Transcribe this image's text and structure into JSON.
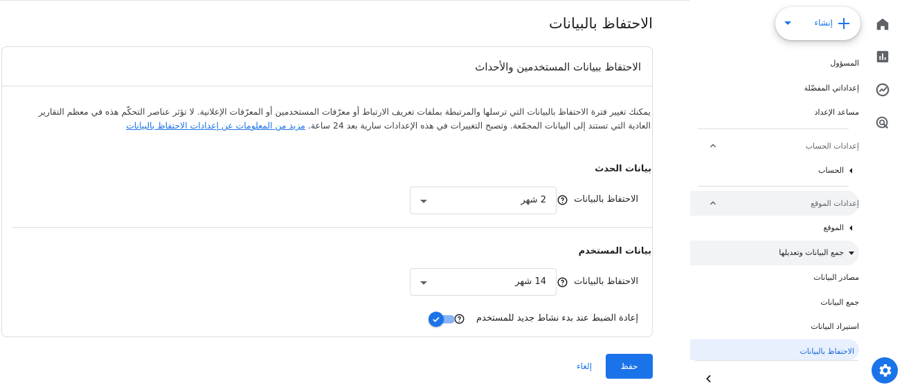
{
  "page": {
    "title": "الاحتفاظ بالبيانات"
  },
  "create_button": {
    "label": "إنشاء"
  },
  "nav": {
    "items_top": [
      "المسؤول",
      "إعداداتي المفضّلة",
      "مساعد الإعداد"
    ],
    "account_section": {
      "label": "إعدادات الحساب",
      "child": "الحساب"
    },
    "property_section": {
      "label": "إعدادات الموقع",
      "child": "الموقع"
    },
    "data_collection": {
      "label": "جمع البيانات وتعديلها",
      "children": [
        "مصادر البيانات",
        "جمع البيانات",
        "استيراد البيانات"
      ],
      "active": "الاحتفاظ بالبيانات"
    }
  },
  "card": {
    "title": "الاحتفاظ ببيانات المستخدمين والأحداث",
    "description_line1": "يمكنك تغيير فترة الاحتفاظ بالبيانات التي ترسلها والمرتبطة بملفات تعريف الارتباط أو معرّفات المستخدمين أو المعرّفات الإعلانية. لا تؤثر عناصر التحكّم هذه في",
    "description_line2": "معظم التقارير العادية التي تستند إلى البيانات المجمّعة. وتصبح التغييرات في هذه الإعدادات سارية بعد 24 ساعة.",
    "learn_more": "مزيد من المعلومات عن إعدادات الاحتفاظ بالبيانات",
    "event_section": {
      "heading": "بيانات الحدث",
      "label": "الاحتفاظ بالبيانات",
      "value": "2 شهر"
    },
    "user_section": {
      "heading": "بيانات المستخدم",
      "label": "الاحتفاظ بالبيانات",
      "value": "14 شهر",
      "reset_label": "إعادة الضبط عند بدء نشاط جديد للمستخدم",
      "reset_enabled": true
    }
  },
  "actions": {
    "save": "حفظ",
    "cancel": "إلغاء"
  },
  "colors": {
    "accent": "#1a73e8",
    "active_nav_bg": "#e8f0fe"
  }
}
